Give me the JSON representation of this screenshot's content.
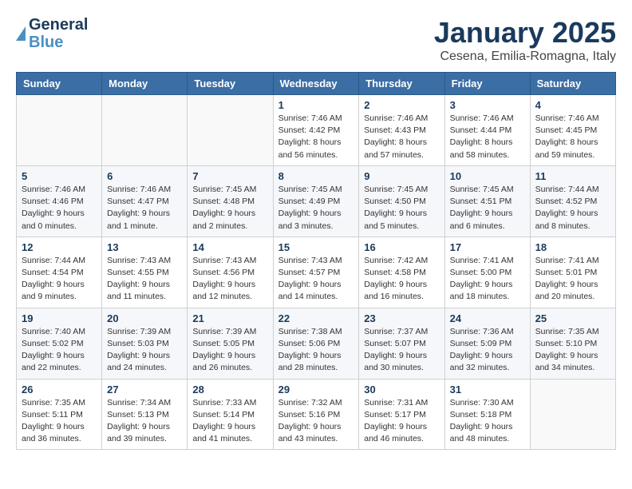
{
  "header": {
    "logo_general": "General",
    "logo_blue": "Blue",
    "month_title": "January 2025",
    "location": "Cesena, Emilia-Romagna, Italy"
  },
  "weekdays": [
    "Sunday",
    "Monday",
    "Tuesday",
    "Wednesday",
    "Thursday",
    "Friday",
    "Saturday"
  ],
  "weeks": [
    [
      {
        "day": "",
        "info": ""
      },
      {
        "day": "",
        "info": ""
      },
      {
        "day": "",
        "info": ""
      },
      {
        "day": "1",
        "info": "Sunrise: 7:46 AM\nSunset: 4:42 PM\nDaylight: 8 hours\nand 56 minutes."
      },
      {
        "day": "2",
        "info": "Sunrise: 7:46 AM\nSunset: 4:43 PM\nDaylight: 8 hours\nand 57 minutes."
      },
      {
        "day": "3",
        "info": "Sunrise: 7:46 AM\nSunset: 4:44 PM\nDaylight: 8 hours\nand 58 minutes."
      },
      {
        "day": "4",
        "info": "Sunrise: 7:46 AM\nSunset: 4:45 PM\nDaylight: 8 hours\nand 59 minutes."
      }
    ],
    [
      {
        "day": "5",
        "info": "Sunrise: 7:46 AM\nSunset: 4:46 PM\nDaylight: 9 hours\nand 0 minutes."
      },
      {
        "day": "6",
        "info": "Sunrise: 7:46 AM\nSunset: 4:47 PM\nDaylight: 9 hours\nand 1 minute."
      },
      {
        "day": "7",
        "info": "Sunrise: 7:45 AM\nSunset: 4:48 PM\nDaylight: 9 hours\nand 2 minutes."
      },
      {
        "day": "8",
        "info": "Sunrise: 7:45 AM\nSunset: 4:49 PM\nDaylight: 9 hours\nand 3 minutes."
      },
      {
        "day": "9",
        "info": "Sunrise: 7:45 AM\nSunset: 4:50 PM\nDaylight: 9 hours\nand 5 minutes."
      },
      {
        "day": "10",
        "info": "Sunrise: 7:45 AM\nSunset: 4:51 PM\nDaylight: 9 hours\nand 6 minutes."
      },
      {
        "day": "11",
        "info": "Sunrise: 7:44 AM\nSunset: 4:52 PM\nDaylight: 9 hours\nand 8 minutes."
      }
    ],
    [
      {
        "day": "12",
        "info": "Sunrise: 7:44 AM\nSunset: 4:54 PM\nDaylight: 9 hours\nand 9 minutes."
      },
      {
        "day": "13",
        "info": "Sunrise: 7:43 AM\nSunset: 4:55 PM\nDaylight: 9 hours\nand 11 minutes."
      },
      {
        "day": "14",
        "info": "Sunrise: 7:43 AM\nSunset: 4:56 PM\nDaylight: 9 hours\nand 12 minutes."
      },
      {
        "day": "15",
        "info": "Sunrise: 7:43 AM\nSunset: 4:57 PM\nDaylight: 9 hours\nand 14 minutes."
      },
      {
        "day": "16",
        "info": "Sunrise: 7:42 AM\nSunset: 4:58 PM\nDaylight: 9 hours\nand 16 minutes."
      },
      {
        "day": "17",
        "info": "Sunrise: 7:41 AM\nSunset: 5:00 PM\nDaylight: 9 hours\nand 18 minutes."
      },
      {
        "day": "18",
        "info": "Sunrise: 7:41 AM\nSunset: 5:01 PM\nDaylight: 9 hours\nand 20 minutes."
      }
    ],
    [
      {
        "day": "19",
        "info": "Sunrise: 7:40 AM\nSunset: 5:02 PM\nDaylight: 9 hours\nand 22 minutes."
      },
      {
        "day": "20",
        "info": "Sunrise: 7:39 AM\nSunset: 5:03 PM\nDaylight: 9 hours\nand 24 minutes."
      },
      {
        "day": "21",
        "info": "Sunrise: 7:39 AM\nSunset: 5:05 PM\nDaylight: 9 hours\nand 26 minutes."
      },
      {
        "day": "22",
        "info": "Sunrise: 7:38 AM\nSunset: 5:06 PM\nDaylight: 9 hours\nand 28 minutes."
      },
      {
        "day": "23",
        "info": "Sunrise: 7:37 AM\nSunset: 5:07 PM\nDaylight: 9 hours\nand 30 minutes."
      },
      {
        "day": "24",
        "info": "Sunrise: 7:36 AM\nSunset: 5:09 PM\nDaylight: 9 hours\nand 32 minutes."
      },
      {
        "day": "25",
        "info": "Sunrise: 7:35 AM\nSunset: 5:10 PM\nDaylight: 9 hours\nand 34 minutes."
      }
    ],
    [
      {
        "day": "26",
        "info": "Sunrise: 7:35 AM\nSunset: 5:11 PM\nDaylight: 9 hours\nand 36 minutes."
      },
      {
        "day": "27",
        "info": "Sunrise: 7:34 AM\nSunset: 5:13 PM\nDaylight: 9 hours\nand 39 minutes."
      },
      {
        "day": "28",
        "info": "Sunrise: 7:33 AM\nSunset: 5:14 PM\nDaylight: 9 hours\nand 41 minutes."
      },
      {
        "day": "29",
        "info": "Sunrise: 7:32 AM\nSunset: 5:16 PM\nDaylight: 9 hours\nand 43 minutes."
      },
      {
        "day": "30",
        "info": "Sunrise: 7:31 AM\nSunset: 5:17 PM\nDaylight: 9 hours\nand 46 minutes."
      },
      {
        "day": "31",
        "info": "Sunrise: 7:30 AM\nSunset: 5:18 PM\nDaylight: 9 hours\nand 48 minutes."
      },
      {
        "day": "",
        "info": ""
      }
    ]
  ]
}
